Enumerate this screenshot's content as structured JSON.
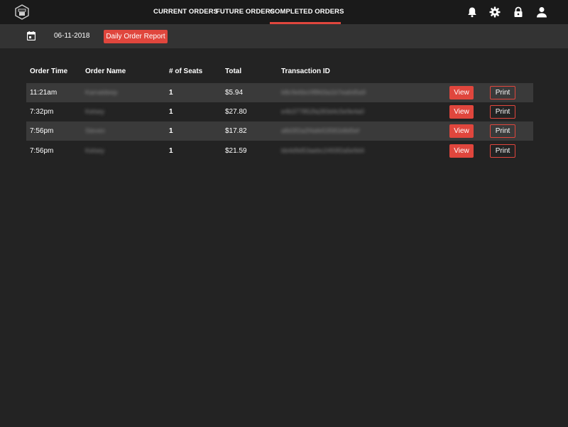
{
  "nav": {
    "tabs": [
      {
        "label": "CURRENT ORDERS",
        "active": false
      },
      {
        "label": "FUTURE ORDERS",
        "active": false
      },
      {
        "label": "COMPLETED ORDERS",
        "active": true
      }
    ],
    "icons": [
      "bell-icon",
      "gear-icon",
      "lock-icon",
      "user-icon"
    ]
  },
  "subbar": {
    "date": "06-11-2018",
    "report_label": "Daily Order Report"
  },
  "table": {
    "headers": [
      "Order Time",
      "Order Name",
      "# of Seats",
      "Total",
      "Transaction ID"
    ],
    "rows": [
      {
        "time": "11:21am",
        "name": "Kamaldeep",
        "seats": "1",
        "total": "$5.94",
        "txn": "b8c9e6bc0f8fd3a1b7ea6d5a9",
        "view": "View",
        "print": "Print"
      },
      {
        "time": "7:32pm",
        "name": "Kelsey",
        "seats": "1",
        "total": "$27.80",
        "txn": "e4b377852fa283d4c5e9e4a0",
        "view": "View",
        "print": "Print"
      },
      {
        "time": "7:56pm",
        "name": "Steven",
        "seats": "1",
        "total": "$17.82",
        "txn": "a8d3f2a2f4afe53581b8d5ef",
        "view": "View",
        "print": "Print"
      },
      {
        "time": "7:56pm",
        "name": "Kelsey",
        "seats": "1",
        "total": "$21.59",
        "txn": "bb4d9d53aebc2493f2a5e9d4",
        "view": "View",
        "print": "Print"
      }
    ]
  },
  "colors": {
    "accent": "#e0463d",
    "topbar": "#1a1a1a",
    "subbar": "#333333",
    "background": "#232323",
    "row_shaded": "#3a3a3a"
  }
}
